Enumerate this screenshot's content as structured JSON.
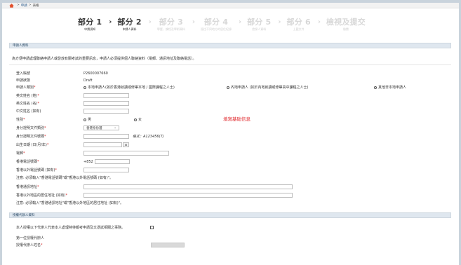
{
  "breadcrumb": {
    "home": "⌂",
    "items": [
      "申請",
      "表格"
    ]
  },
  "steps": [
    {
      "main": "部分 1",
      "sub": "申請須知",
      "state": "active"
    },
    {
      "main": "部分 2",
      "sub": "申請人資料",
      "state": "active"
    },
    {
      "main": "部分 3",
      "sub": "學歷、課程及學術資料",
      "state": "inactive"
    },
    {
      "main": "部分 4",
      "sub": "過往不同地方的居住紀錄",
      "state": "inactive"
    },
    {
      "main": "部分 5",
      "sub": "擔保人資料",
      "state": "inactive"
    },
    {
      "main": "部分 6",
      "sub": "上載文件",
      "state": "inactive"
    },
    {
      "main": "檢視及提交",
      "sub": "檢閱",
      "state": "inactive"
    }
  ],
  "applicant": {
    "section_title": "申請人資料",
    "notice": "為方便申請處理聯絡申請人或發放有關考試的重要訊息，申請人必須提供個人聯絡資料（電郵、通訊地址及聯絡電話）。",
    "reg_label": "登入賬號",
    "reg_value": "P2600007660",
    "status_label": "申請狀態",
    "status_value": "Draft",
    "category_label": "申請人類別",
    "category_options": [
      "本地申請人(如於香港就讀或修畢本地 / 國際課程之人士)",
      "內地申請人 (如於內地就讀或修畢高中課程之人士)",
      "其他非本地申請人"
    ],
    "surname_label": "英文姓名 (姓)",
    "given_label": "英文姓名 (名)",
    "chinese_label": "中文姓名 (如有)",
    "gender_label": "性別",
    "gender_options": [
      "男",
      "女"
    ],
    "hint": "填寫基础信息",
    "id_type_label": "身分證明文件類別",
    "id_type_value": "香港身份證",
    "id_no_label": "身分證明文件號碼",
    "id_format": "格式：A123456(7)",
    "dob_label": "出生日期 (日/月/年)",
    "dob_btn": "⊞",
    "email_label": "電郵",
    "hk_phone_label": "香港電話號碼",
    "hk_phone_prefix": "+852",
    "other_phone_label": "香港以外電話號碼 (如有)",
    "phone_note": "注意: 必須輸入\"香港電話號碼\"或\"香港以外電話號碼 (如有)\"。",
    "hk_addr_label": "香港通訊地址",
    "other_addr_label": "香港以外地區的居住地址 (如有)",
    "addr_note": "注意: 必須輸入\"香港通訊地址\"或\"香港以外地區的居住地址 (如有)\"。"
  },
  "agent": {
    "section_title": "授權代辦人資料",
    "authorize_text": "本人授權以下代辦人代表本人處理特待報考申請及文憑試相關之事務。",
    "first_label": "第一位授權代辦人",
    "name_label": "授權代辦人姓名"
  },
  "colors": {
    "required": "#d21f1f",
    "hint": "#e0262a",
    "section_bg": "#dfe7ef"
  }
}
